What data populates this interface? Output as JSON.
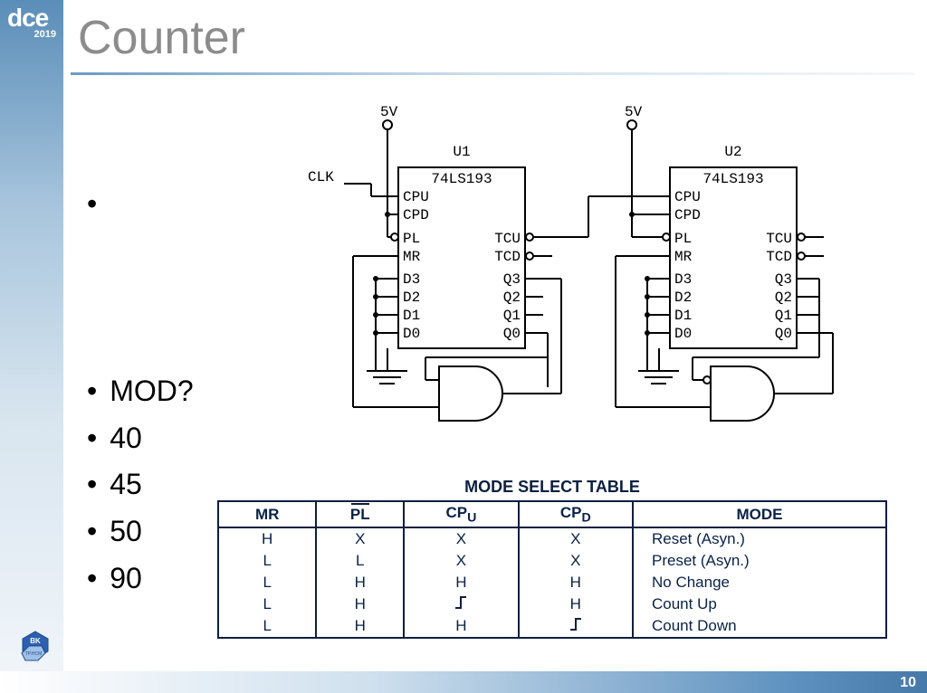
{
  "logo": {
    "text": "dce",
    "year": "2019"
  },
  "title": "Counter",
  "bullets": [
    "",
    "MOD?",
    "40",
    "45",
    "50",
    "90"
  ],
  "circuit": {
    "voltage": "5V",
    "clk": "CLK",
    "chips": [
      {
        "ref": "U1",
        "part": "74LS193"
      },
      {
        "ref": "U2",
        "part": "74LS193"
      }
    ],
    "pins_left": [
      "CPU",
      "CPD",
      "PL",
      "MR",
      "D3",
      "D2",
      "D1",
      "D0"
    ],
    "pins_right": [
      "TCU",
      "TCD",
      "Q3",
      "Q2",
      "Q1",
      "Q0"
    ]
  },
  "mode_table": {
    "title": "MODE SELECT TABLE",
    "headers": [
      "MR",
      "PL",
      "CPU",
      "CPD",
      "MODE"
    ],
    "sub_u": "U",
    "sub_d": "D",
    "rows": [
      {
        "mr": "H",
        "pl": "X",
        "cpu": "X",
        "cpd": "X",
        "mode": "Reset (Asyn.)"
      },
      {
        "mr": "L",
        "pl": "L",
        "cpu": "X",
        "cpd": "X",
        "mode": "Preset (Asyn.)"
      },
      {
        "mr": "L",
        "pl": "H",
        "cpu": "H",
        "cpd": "H",
        "mode": "No Change"
      },
      {
        "mr": "L",
        "pl": "H",
        "cpu": "edge",
        "cpd": "H",
        "mode": "Count Up"
      },
      {
        "mr": "L",
        "pl": "H",
        "cpu": "H",
        "cpd": "edge",
        "mode": "Count Down"
      }
    ]
  },
  "page_number": "10",
  "bk_label": {
    "top": "BK",
    "bottom": "TP.HCM"
  }
}
